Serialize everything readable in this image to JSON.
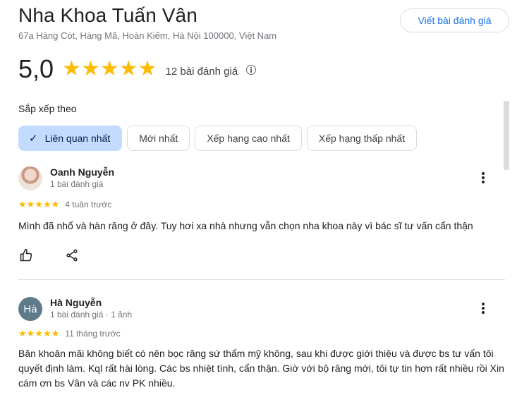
{
  "header": {
    "title": "Nha Khoa Tuấn Vân",
    "address": "67a Hàng Cót, Hàng Mã, Hoàn Kiếm, Hà Nội 100000, Việt Nam",
    "write_review": "Viết bài đánh giá"
  },
  "summary": {
    "rating": "5,0",
    "stars": "★★★★★",
    "count": "12 bài đánh giá",
    "star_color": "#fbbc04"
  },
  "sort": {
    "label": "Sắp xếp theo",
    "options": [
      {
        "label": "Liên quan nhất",
        "selected": true
      },
      {
        "label": "Mới nhất"
      },
      {
        "label": "Xếp hạng cao nhất"
      },
      {
        "label": "Xếp hạng thấp nhất"
      }
    ],
    "check_glyph": "✓"
  },
  "reviews": [
    {
      "name": "Oanh Nguyễn",
      "meta": "1 bài đánh giá",
      "stars": "★★★★★",
      "when": "4 tuần trước",
      "text": "Mình đã nhổ và hàn răng ở đây. Tuy hơi xa nhà nhưng vẫn chọn nha khoa này vì bác sĩ tư vấn cẩn thận"
    },
    {
      "name": "Hà Nguyễn",
      "avatar_text": "Hà",
      "meta": "1 bài đánh giá · 1 ảnh",
      "stars": "★★★★★",
      "when": "11 tháng trước",
      "text": "Băn khoăn mãi không biết có nên bọc răng sứ thẩm mỹ không, sau khi được giới thiệu và được bs tư vấn tôi quyết định làm. Kql rất hài lòng. Các bs nhiệt tình, cẩn thận. Giờ với bộ răng mới, tôi tự tin hơn rất nhiều rồi Xin cám ơn bs Vân và các nv PK nhiều."
    }
  ],
  "icons": [
    "info-icon",
    "check-icon",
    "more-vert-icon",
    "thumbs-up-icon",
    "share-icon",
    "avatar-photo"
  ]
}
